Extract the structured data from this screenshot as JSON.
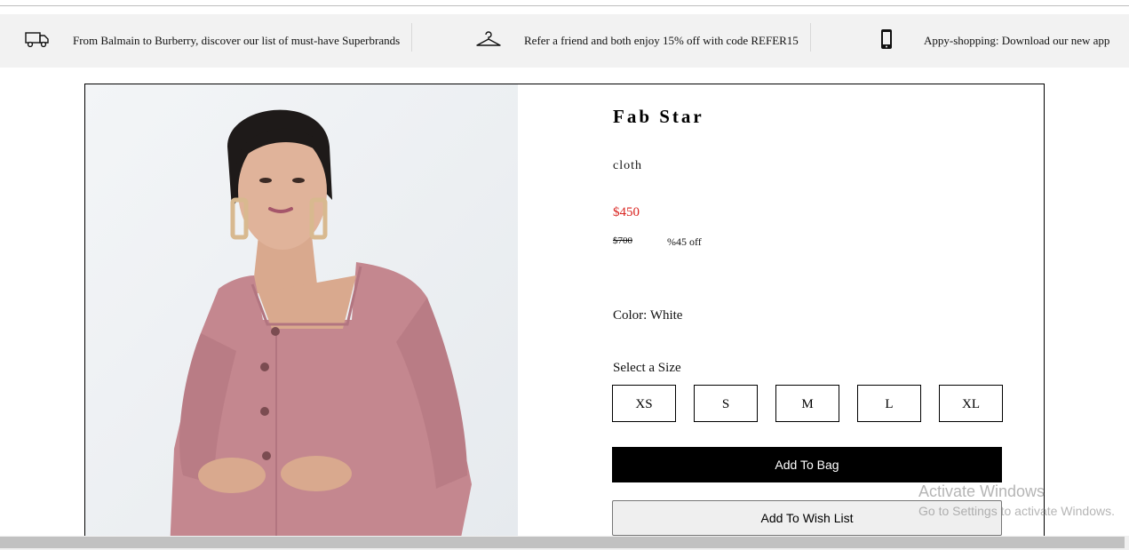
{
  "promos": [
    {
      "icon": "delivery-truck-icon",
      "text": "From Balmain to Burberry, discover our list of must-have Superbrands"
    },
    {
      "icon": "hanger-icon",
      "text": "Refer a friend and both enjoy 15% off with code REFER15"
    },
    {
      "icon": "mobile-phone-icon",
      "text": "Appy-shopping: Download our new app"
    }
  ],
  "product": {
    "title": "Fab Star",
    "brand": "cloth",
    "price": "$450",
    "old_price": "$700",
    "discount": "%45 off",
    "color_label": "Color: White",
    "size_label": "Select a Size",
    "sizes": [
      "XS",
      "S",
      "M",
      "L",
      "XL"
    ],
    "add_to_bag": "Add To Bag",
    "add_to_wishlist": "Add To Wish List",
    "image_alt": "model wearing pink long-sleeve top"
  },
  "colors": {
    "price": "#d9231f",
    "bag_button": "#000000",
    "promo_bar": "#f2f2f2"
  },
  "watermark": {
    "title": "Activate Windows",
    "subtitle": "Go to Settings to activate Windows."
  }
}
